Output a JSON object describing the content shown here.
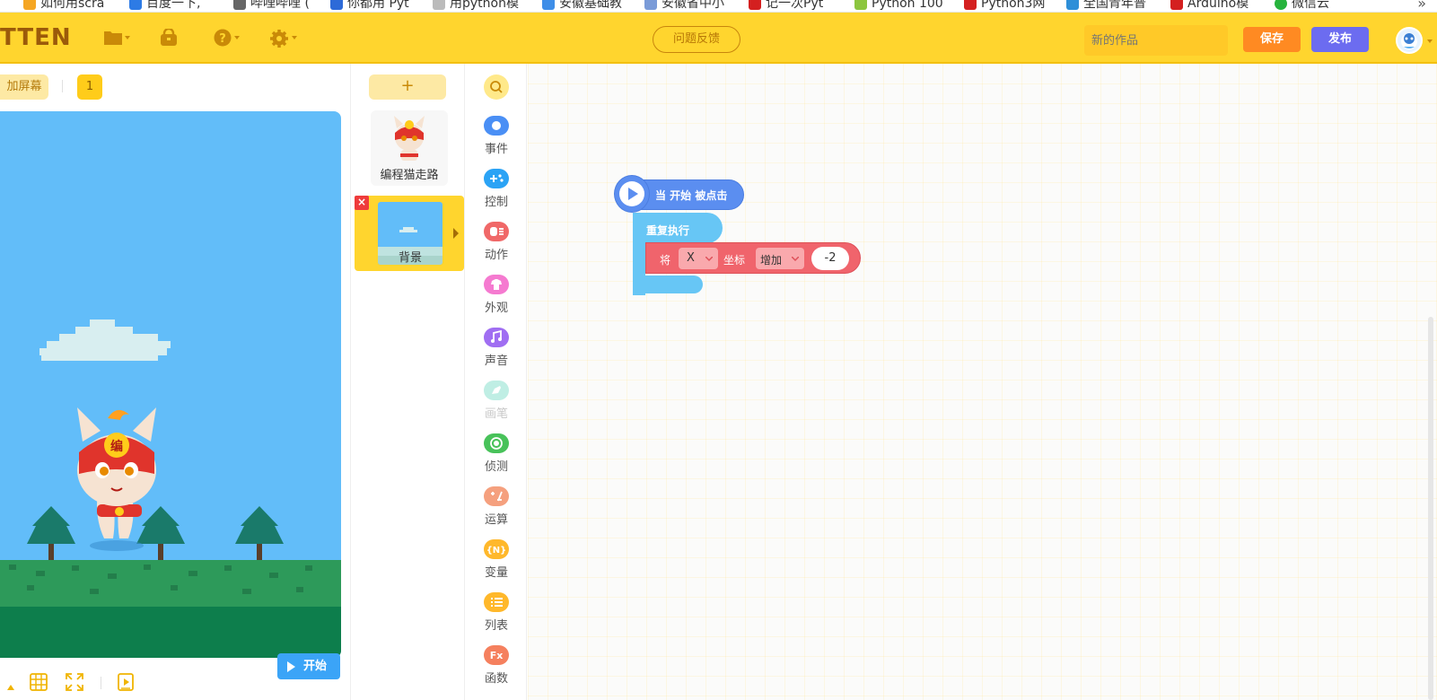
{
  "bookmarks": [
    "如何用scra",
    "百度一下,",
    "哔哩哔哩 (",
    "你都用 Pyt",
    "用python模",
    "安徽基础教",
    "安徽省中小",
    "记一次Pyt",
    "Python 100",
    "Python3网",
    "全国青年普",
    "Arduino模",
    "微信云"
  ],
  "bookmarks_more": "»",
  "header": {
    "logo": "TTEN",
    "feedback": "问题反馈",
    "name_placeholder": "新的作品",
    "save": "保存",
    "publish": "发布",
    "icons": [
      "folder-icon",
      "bag-icon",
      "help-icon",
      "settings-icon"
    ]
  },
  "stage": {
    "screen_label": "加屏幕",
    "scene_number": "1",
    "start_button": "开始"
  },
  "sprites": {
    "add": "+",
    "items": [
      {
        "label": "编程猫走路"
      }
    ],
    "background": {
      "label": "背景",
      "delete": "×"
    }
  },
  "categories": [
    {
      "label": "事件",
      "color": "#4a8ff5",
      "icon": "event-icon"
    },
    {
      "label": "控制",
      "color": "#2ba3f5",
      "icon": "control-icon"
    },
    {
      "label": "动作",
      "color": "#f06868",
      "icon": "motion-icon"
    },
    {
      "label": "外观",
      "color": "#f57ad0",
      "icon": "looks-icon"
    },
    {
      "label": "声音",
      "color": "#a06ef2",
      "icon": "sound-icon"
    },
    {
      "label": "画笔",
      "color": "#bfeee4",
      "icon": "pen-icon",
      "disabled": true
    },
    {
      "label": "侦测",
      "color": "#48c25a",
      "icon": "sensing-icon"
    },
    {
      "label": "运算",
      "color": "#f5a07e",
      "icon": "operator-icon"
    },
    {
      "label": "变量",
      "color": "#ffb82b",
      "icon": "variable-icon"
    },
    {
      "label": "列表",
      "color": "#ffb82b",
      "icon": "list-icon"
    },
    {
      "label": "函数",
      "color": "#f5805e",
      "icon": "function-icon"
    }
  ],
  "blocks": {
    "hat": "当 开始 被点击",
    "repeat": "重复执行",
    "motion": {
      "prefix": "将",
      "axis": "X",
      "label": "坐标",
      "op": "增加",
      "value": "-2"
    }
  }
}
